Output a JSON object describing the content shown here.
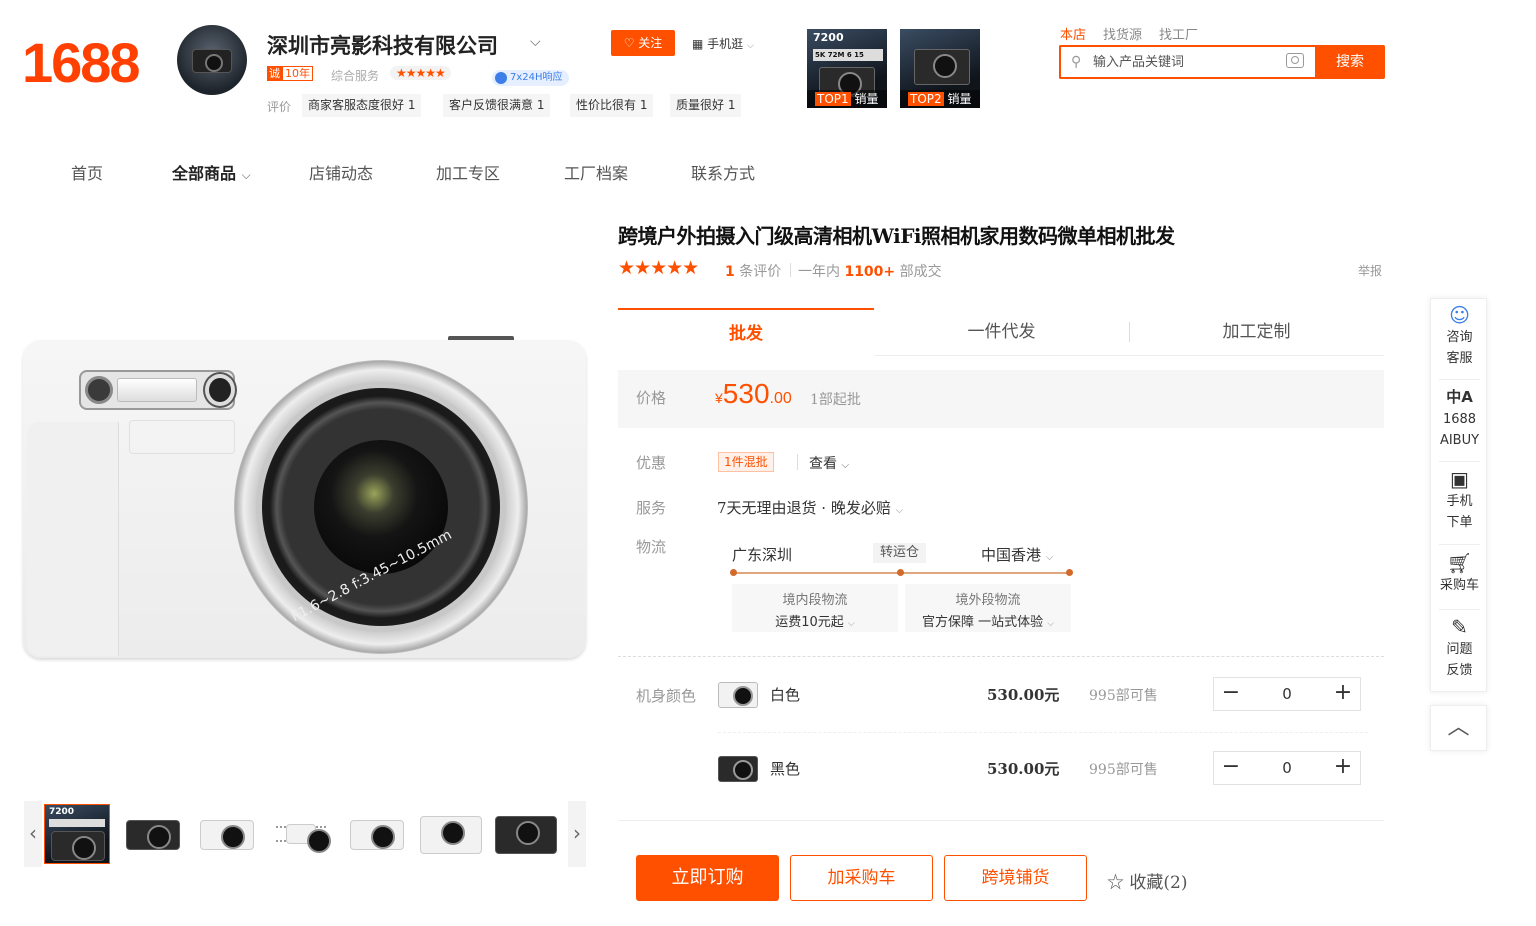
{
  "header": {
    "logo": "1688",
    "company_name": "深圳市亮影科技有限公司",
    "cheng_a": "诚",
    "cheng_b": "10年",
    "service_label": "综合服务",
    "service_stars": "★★★★★",
    "response_badge": "7x24H响应",
    "review_label": "评价",
    "review_tags": [
      "商家客服态度很好 1",
      "客户反馈很满意 1",
      "性价比很有 1",
      "质量很好 1"
    ],
    "follow_label": "关注",
    "mobile_label": "手机逛",
    "top_products": [
      {
        "rank": "TOP1",
        "label": "销量",
        "banner": "7200",
        "specs": "5K 72M 6 15"
      },
      {
        "rank": "TOP2",
        "label": "销量"
      }
    ]
  },
  "search": {
    "tabs": [
      "本店",
      "找货源",
      "找工厂"
    ],
    "active_tab": 0,
    "placeholder": "输入产品关键词",
    "button_label": "搜索"
  },
  "nav": {
    "items": [
      "首页",
      "全部商品",
      "店铺动态",
      "加工专区",
      "工厂档案",
      "联系方式"
    ],
    "active": 1
  },
  "product": {
    "title": "跨境户外拍摄入门级高清相机WiFi照相机家用数码微单相机批发",
    "rating_stars": "★★★★★",
    "review_count": "1",
    "review_suffix": " 条评价",
    "deal_prefix": "一年内 ",
    "deal_count": "1100+",
    "deal_suffix": " 部成交",
    "report": "举报",
    "lens_text": "F1.6~2.8 f:3.45~10.5mm",
    "thumb_banner": "7200"
  },
  "tabs": [
    "批发",
    "一件代发",
    "加工定制"
  ],
  "price": {
    "label": "价格",
    "currency": "¥",
    "integer": "530",
    "decimal": ".00",
    "min_order": "1部起批"
  },
  "promo": {
    "label": "优惠",
    "tag": "1件混批",
    "view": "查看"
  },
  "service": {
    "label": "服务",
    "value": "7天无理由退货 · 晚发必赔"
  },
  "logistics": {
    "label": "物流",
    "from": "广东深圳",
    "via": "转运仓",
    "to": "中国香港",
    "domestic_title": "境内段物流",
    "domestic_value": "运费10元起",
    "overseas_title": "境外段物流",
    "overseas_value": "官方保障 一站式体验"
  },
  "variants": {
    "label": "机身颜色",
    "items": [
      {
        "name": "白色",
        "price": "530.00元",
        "stock": "995部可售",
        "qty": "0"
      },
      {
        "name": "黑色",
        "price": "530.00元",
        "stock": "995部可售",
        "qty": "0"
      }
    ]
  },
  "actions": {
    "buy": "立即订购",
    "cart": "加采购车",
    "crossborder": "跨境铺货",
    "favorite": "收藏(2)"
  },
  "sidebar": {
    "items": [
      {
        "line1": "咨询",
        "line2": "客服",
        "icon": "chat-icon"
      },
      {
        "line1": "1688",
        "line2": "AIBUY",
        "icon": "translate-icon"
      },
      {
        "line1": "手机",
        "line2": "下单",
        "icon": "qrcode-icon"
      },
      {
        "line1": "采购车",
        "line2": "",
        "icon": "cart-icon"
      },
      {
        "line1": "问题",
        "line2": "反馈",
        "icon": "edit-icon"
      }
    ]
  },
  "colors": {
    "brand": "#ff5000"
  }
}
